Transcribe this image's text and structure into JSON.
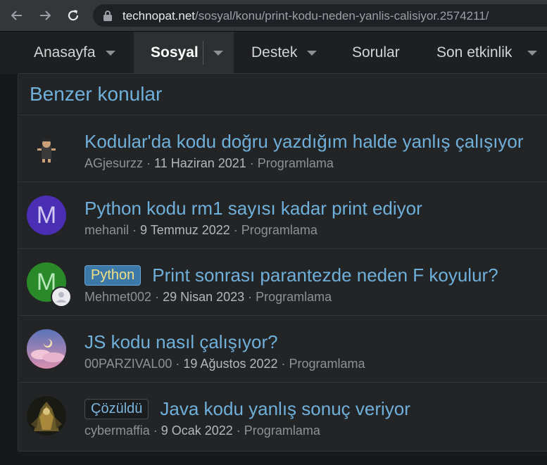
{
  "browser": {
    "url_host": "technopat.net",
    "url_path": "/sosyal/konu/print-kodu-neden-yanlis-calisiyor.2574211/"
  },
  "nav": {
    "tabs": [
      {
        "label": "Anasayfa"
      },
      {
        "label": "Sosyal"
      },
      {
        "label": "Destek"
      },
      {
        "label": "Sorular"
      },
      {
        "label": "Son etkinlik"
      }
    ]
  },
  "block": {
    "title": "Benzer konular",
    "threads": [
      {
        "title": "Kodular'da kodu doğru yazdığım halde yanlış çalışıyor",
        "author": "AGjesurzz",
        "date": "11 Haziran 2021",
        "forum": "Programlama",
        "prefix": ""
      },
      {
        "title": "Python kodu rm1 sayısı kadar print ediyor",
        "author": "mehanil",
        "date": "9 Temmuz 2022",
        "forum": "Programlama",
        "prefix": "",
        "avatar_letter": "M"
      },
      {
        "title": "Print sonrası parantezde neden F koyulur?",
        "author": "Mehmet002",
        "date": "29 Nisan 2023",
        "forum": "Programlama",
        "prefix": "Python",
        "avatar_letter": "M"
      },
      {
        "title": "JS kodu nasıl çalışıyor?",
        "author": "00PARZIVAL00",
        "date": "19 Ağustos 2022",
        "forum": "Programlama",
        "prefix": ""
      },
      {
        "title": "Java kodu yanlış sonuç veriyor",
        "author": "cybermaffia",
        "date": "9 Ocak 2022",
        "forum": "Programlama",
        "prefix": "Çözüldü"
      }
    ]
  },
  "colors": {
    "link": "#6fb0db",
    "avatar_purple": "#4a2fb5",
    "avatar_green": "#2a8a2a",
    "prefix_python_bg": "#3d79a8"
  },
  "icons": [
    "back-arrow-icon",
    "forward-arrow-icon",
    "reload-icon",
    "lock-icon",
    "chevron-down-icon"
  ]
}
